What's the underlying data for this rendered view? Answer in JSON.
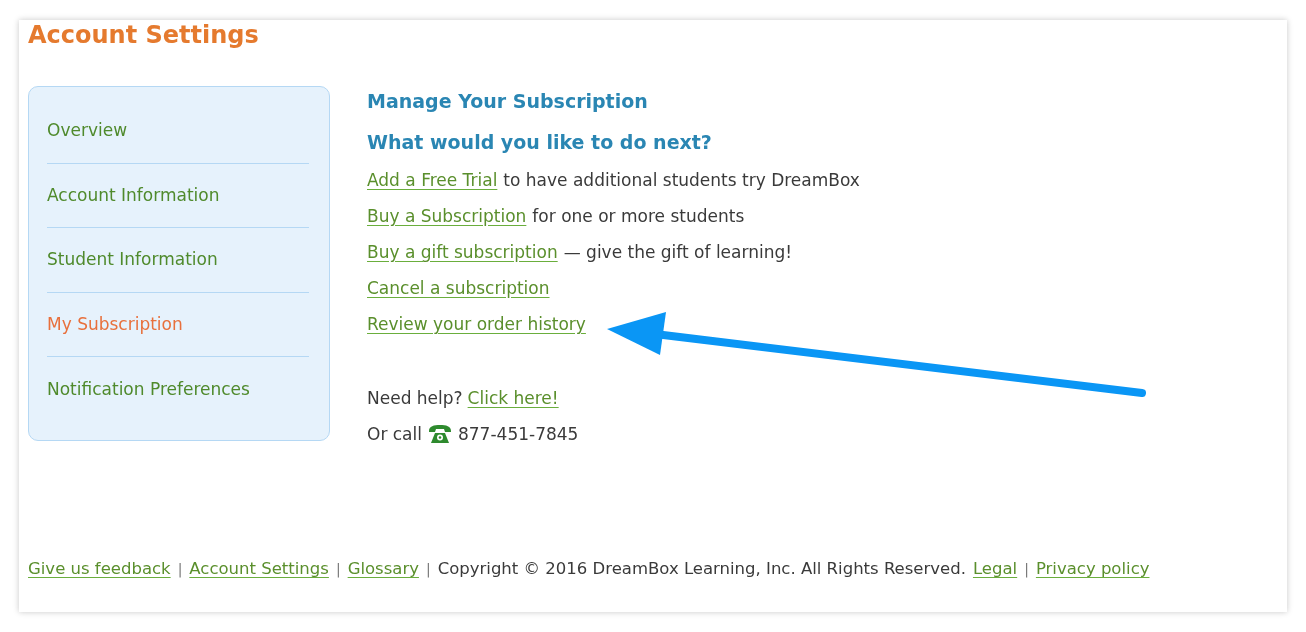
{
  "page": {
    "title": "Account Settings"
  },
  "sidebar": {
    "items": [
      {
        "label": "Overview",
        "selected": false
      },
      {
        "label": "Account Information",
        "selected": false
      },
      {
        "label": "Student Information",
        "selected": false
      },
      {
        "label": "My Subscription",
        "selected": true
      },
      {
        "label": "Notification Preferences",
        "selected": false
      }
    ]
  },
  "main": {
    "heading": "Manage Your Subscription",
    "subheading": "What would you like to do next?",
    "actions": [
      {
        "link": "Add a Free Trial",
        "text": "to have additional students try DreamBox"
      },
      {
        "link": "Buy a Subscription",
        "text": "for one or more students"
      },
      {
        "link": "Buy a gift subscription",
        "text": "— give the gift of learning!"
      },
      {
        "link": "Cancel a subscription"
      },
      {
        "link": "Review your order history"
      }
    ],
    "help": {
      "text": "Need help?",
      "link": "Click here!"
    },
    "call": {
      "text": "Or call",
      "phone": "877-451-7845"
    }
  },
  "footer": {
    "items": [
      {
        "kind": "link",
        "text": "Give us feedback"
      },
      {
        "kind": "separator",
        "text": "|"
      },
      {
        "kind": "link",
        "text": "Account Settings"
      },
      {
        "kind": "separator",
        "text": "|"
      },
      {
        "kind": "link",
        "text": "Glossary"
      },
      {
        "kind": "separator",
        "text": "|"
      },
      {
        "kind": "text",
        "text": "Copyright © 2016 DreamBox Learning, Inc. All Rights Reserved."
      },
      {
        "kind": "link",
        "text": "Legal"
      },
      {
        "kind": "separator",
        "text": "|"
      },
      {
        "kind": "link",
        "text": "Privacy policy"
      }
    ]
  }
}
